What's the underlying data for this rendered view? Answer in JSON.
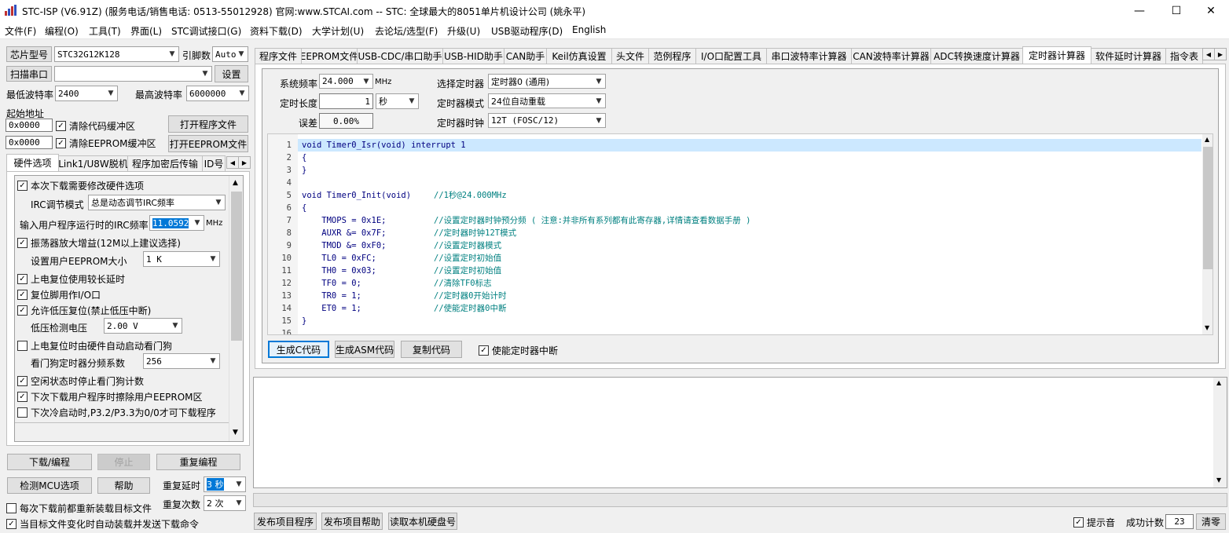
{
  "window": {
    "title": "STC-ISP (V6.91Z) (服务电话/销售电话: 0513-55012928) 官网:www.STCAI.com  -- STC: 全球最大的8051单片机设计公司 (姚永平)",
    "icon": "stc-app-icon",
    "minimize": "—",
    "maximize": "☐",
    "close": "✕"
  },
  "menu": [
    "文件(F)",
    "编程(O)",
    "工具(T)",
    "界面(L)",
    "STC调试接口(G)",
    "资料下载(D)",
    "大学计划(U)",
    "去论坛/选型(F)",
    "升级(U)",
    "USB驱动程序(D)",
    "English"
  ],
  "left": {
    "chip_label": "芯片型号",
    "chip_value": "STC32G12K128",
    "pins_label": "引脚数",
    "pins_value": "Auto",
    "scan_port_label": "扫描串口",
    "port_value": "",
    "settings_label": "设置",
    "min_baud_label": "最低波特率",
    "min_baud_value": "2400",
    "max_baud_label": "最高波特率",
    "max_baud_value": "6000000",
    "start_addr_label": "起始地址",
    "addr1": "0x0000",
    "clear_code_label": "清除代码缓冲区",
    "open_program_label": "打开程序文件",
    "addr2": "0x0000",
    "clear_eeprom_label": "清除EEPROM缓冲区",
    "open_eeprom_label": "打开EEPROM文件",
    "tabs": [
      "硬件选项",
      "Link1/U8W脱机",
      "程序加密后传输",
      "ID号"
    ],
    "hw": {
      "modify_hw": "本次下载需要修改硬件选项",
      "irc_mode_label": "IRC调节模式",
      "irc_mode_value": "总是动态调节IRC频率",
      "irc_freq_label": "输入用户程序运行时的IRC频率",
      "irc_freq_value": "11.0592",
      "irc_freq_unit": "MHz",
      "osc_gain": "振荡器放大增益(12M以上建议选择)",
      "eeprom_size_label": "设置用户EEPROM大小",
      "eeprom_size_value": "1   K",
      "power_delay": "上电复位使用较长延时",
      "reset_pin_io": "复位脚用作I/O口",
      "lvr": "允许低压复位(禁止低压中断)",
      "lvd_label": "低压检测电压",
      "lvd_value": "2.00 V",
      "wdt_auto": "上电复位时由硬件自动启动看门狗",
      "wdt_div_label": "看门狗定时器分频系数",
      "wdt_div_value": "256",
      "idle_wdt": "空闲状态时停止看门狗计数",
      "erase_eeprom": "下次下载用户程序时擦除用户EEPROM区",
      "p32p33": "下次冷启动时,P3.2/P3.3为0/0才可下载程序"
    },
    "download_label": "下载/编程",
    "stop_label": "停止",
    "reprogram_label": "重复编程",
    "check_mcu_label": "检测MCU选项",
    "help_label": "帮助",
    "repeat_delay_label": "重复延时",
    "repeat_delay_value": "3 秒",
    "repeat_count_label": "重复次数",
    "repeat_count_value": "2 次",
    "reload_before": "每次下载前都重新装载目标文件",
    "auto_reload": "当目标文件变化时自动装载并发送下载命令"
  },
  "right": {
    "tabs": [
      "程序文件",
      "EEPROM文件",
      "USB-CDC/串口助手",
      "USB-HID助手",
      "CAN助手",
      "Keil仿真设置",
      "头文件",
      "范例程序",
      "I/O口配置工具",
      "串口波特率计算器",
      "CAN波特率计算器",
      "ADC转换速度计算器",
      "定时器计算器",
      "软件延时计算器",
      "指令表"
    ],
    "active_tab": "定时器计算器",
    "timer": {
      "sysfreq_label": "系统频率",
      "sysfreq_value": "24.000",
      "sysfreq_unit": "MHz",
      "select_label": "选择定时器",
      "select_value": "定时器0 (通用)",
      "length_label": "定时长度",
      "length_value": "1",
      "length_unit": "秒",
      "mode_label": "定时器模式",
      "mode_value": "24位自动重载",
      "error_label": "误差",
      "error_value": "0.00%",
      "clock_label": "定时器时钟",
      "clock_value": "12T (FOSC/12)"
    },
    "code_lines": [
      {
        "n": "1",
        "code": "void Timer0_Isr(void) interrupt 1",
        "comment": ""
      },
      {
        "n": "2",
        "code": "{",
        "comment": ""
      },
      {
        "n": "3",
        "code": "}",
        "comment": ""
      },
      {
        "n": "4",
        "code": "",
        "comment": ""
      },
      {
        "n": "5",
        "code": "void Timer0_Init(void)",
        "comment": "//1秒@24.000MHz"
      },
      {
        "n": "6",
        "code": "{",
        "comment": ""
      },
      {
        "n": "7",
        "code": "    TMOPS = 0x1E;",
        "comment": "//设置定时器时钟预分频 ( 注意:并非所有系列都有此寄存器,详情请查看数据手册 )"
      },
      {
        "n": "8",
        "code": "    AUXR &= 0x7F;",
        "comment": "//定时器时钟12T模式"
      },
      {
        "n": "9",
        "code": "    TMOD &= 0xF0;",
        "comment": "//设置定时器模式"
      },
      {
        "n": "10",
        "code": "    TL0 = 0xFC;",
        "comment": "//设置定时初始值"
      },
      {
        "n": "11",
        "code": "    TH0 = 0x03;",
        "comment": "//设置定时初始值"
      },
      {
        "n": "12",
        "code": "    TF0 = 0;",
        "comment": "//清除TF0标志"
      },
      {
        "n": "13",
        "code": "    TR0 = 1;",
        "comment": "//定时器0开始计时"
      },
      {
        "n": "14",
        "code": "    ET0 = 1;",
        "comment": "//使能定时器0中断"
      },
      {
        "n": "15",
        "code": "}",
        "comment": ""
      },
      {
        "n": "16",
        "code": "",
        "comment": ""
      }
    ],
    "gen_c_label": "生成C代码",
    "gen_asm_label": "生成ASM代码",
    "copy_label": "复制代码",
    "enable_int_label": "使能定时器中断",
    "publish_label": "发布项目程序",
    "publish_help_label": "发布项目帮助",
    "read_disk_label": "读取本机硬盘号",
    "beep_label": "提示音",
    "success_label": "成功计数",
    "success_value": "23",
    "clear_label": "清零"
  }
}
